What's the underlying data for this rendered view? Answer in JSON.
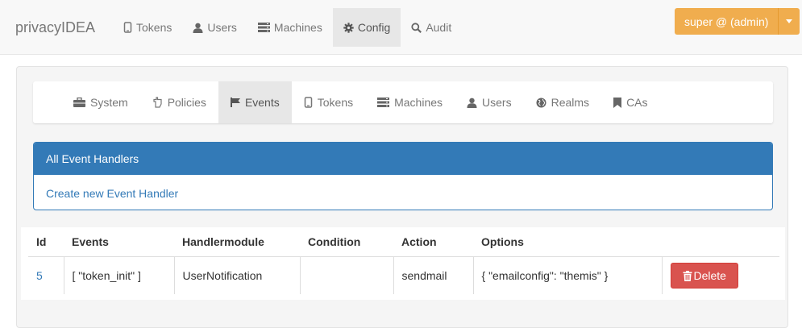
{
  "brand": "privacyIDEA",
  "topnav": [
    {
      "label": "Tokens",
      "icon": "phone-icon",
      "active": false
    },
    {
      "label": "Users",
      "icon": "user-icon",
      "active": false
    },
    {
      "label": "Machines",
      "icon": "server-icon",
      "active": false
    },
    {
      "label": "Config",
      "icon": "cog-icon",
      "active": true
    },
    {
      "label": "Audit",
      "icon": "search-icon",
      "active": false
    }
  ],
  "user_menu": {
    "label": "super @ (admin)"
  },
  "subnav": [
    {
      "label": "System",
      "icon": "briefcase-icon",
      "active": false
    },
    {
      "label": "Policies",
      "icon": "hand-icon",
      "active": false
    },
    {
      "label": "Events",
      "icon": "flag-icon",
      "active": true
    },
    {
      "label": "Tokens",
      "icon": "phone-icon",
      "active": false
    },
    {
      "label": "Machines",
      "icon": "server-icon",
      "active": false
    },
    {
      "label": "Users",
      "icon": "user-icon",
      "active": false
    },
    {
      "label": "Realms",
      "icon": "globe-icon",
      "active": false
    },
    {
      "label": "CAs",
      "icon": "bookmark-icon",
      "active": false
    }
  ],
  "panel": {
    "title": "All Event Handlers",
    "create_link": "Create new Event Handler"
  },
  "table": {
    "headers": [
      "Id",
      "Events",
      "Handlermodule",
      "Condition",
      "Action",
      "Options"
    ],
    "rows": [
      {
        "id": "5",
        "events": "[ \"token_init\" ]",
        "handlermodule": "UserNotification",
        "condition": "",
        "action": "sendmail",
        "options": "{ \"emailconfig\": \"themis\" }",
        "delete_label": "Delete"
      }
    ]
  },
  "colors": {
    "primary": "#337ab7",
    "warning": "#f0ad4e",
    "danger": "#d9534f"
  }
}
